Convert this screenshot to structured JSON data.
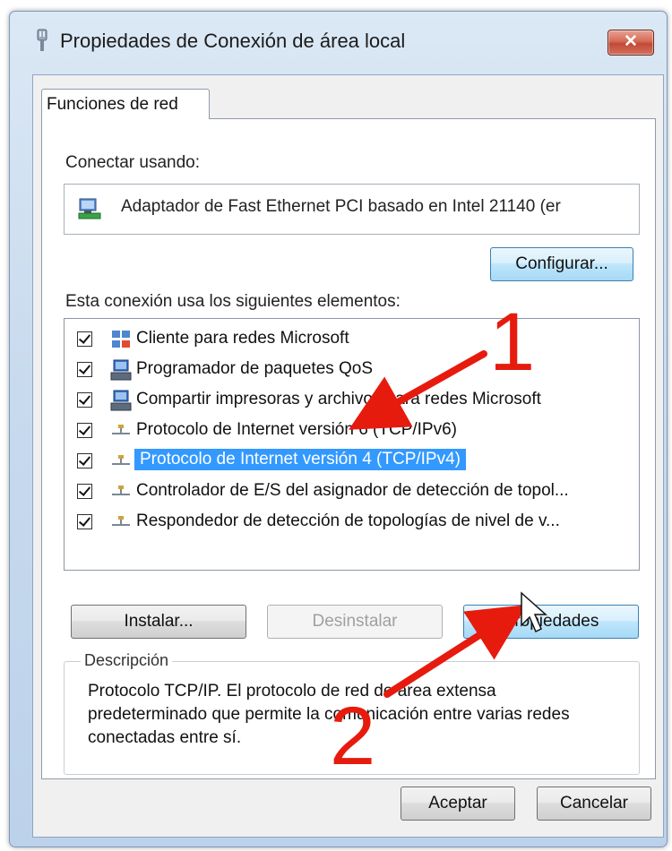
{
  "window": {
    "title": "Propiedades de Conexión de área local",
    "close_label": "✕",
    "icon": "network-connection-icon"
  },
  "tab": {
    "label": "Funciones de red"
  },
  "connect": {
    "label": "Conectar usando:",
    "adapter_name": "Adaptador de Fast Ethernet PCI basado en Intel 21140 (er",
    "adapter_icon": "network-adapter-icon",
    "configure_label": "Configurar..."
  },
  "components": {
    "label": "Esta conexión usa los siguientes elementos:",
    "items": [
      {
        "label": "Cliente para redes Microsoft",
        "checked": true,
        "icon": "network-client-icon",
        "selected": false
      },
      {
        "label": "Programador de paquetes QoS",
        "checked": true,
        "icon": "network-service-icon",
        "selected": false
      },
      {
        "label": "Compartir impresoras y archivos para redes Microsoft",
        "checked": true,
        "icon": "network-service-icon",
        "selected": false
      },
      {
        "label": "Protocolo de Internet versión 6 (TCP/IPv6)",
        "checked": true,
        "icon": "network-protocol-icon",
        "selected": false
      },
      {
        "label": "Protocolo de Internet versión 4 (TCP/IPv4)",
        "checked": true,
        "icon": "network-protocol-icon",
        "selected": true
      },
      {
        "label": "Controlador de E/S del asignador de detección de topol...",
        "checked": true,
        "icon": "network-protocol-icon",
        "selected": false
      },
      {
        "label": "Respondedor de detección de topologías de nivel de v...",
        "checked": true,
        "icon": "network-protocol-icon",
        "selected": false
      }
    ]
  },
  "buttons": {
    "install": "Instalar...",
    "uninstall": "Desinstalar",
    "properties": "Propiedades",
    "ok": "Aceptar",
    "cancel": "Cancelar"
  },
  "description": {
    "title": "Descripción",
    "text": "Protocolo TCP/IP. El protocolo de red de área extensa predeterminado que permite la comunicación entre varias redes conectadas entre sí."
  },
  "annotations": {
    "step1": "1",
    "step2": "2",
    "arrow_color": "#e61b0e"
  }
}
